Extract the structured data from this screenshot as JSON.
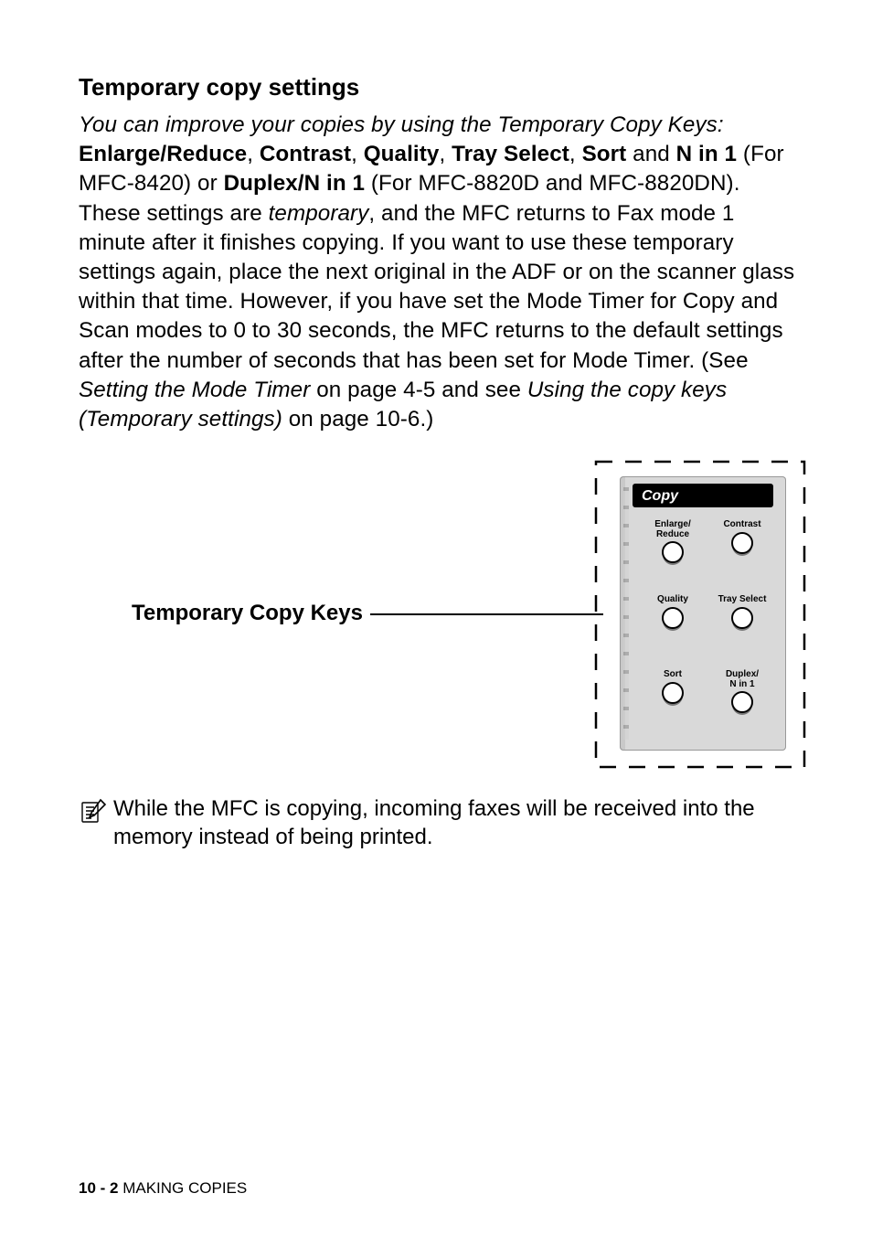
{
  "heading": "Temporary copy settings",
  "body": {
    "intro_italic": "You can improve your copies by using the Temporary Copy Keys: ",
    "k1": "Enlarge/Reduce",
    "c1": ", ",
    "k2": "Contrast",
    "c2": ", ",
    "k3": "Quality",
    "c3": ", ",
    "k4": "Tray Select",
    "c4": ", ",
    "k5": "Sort",
    "t1": " and ",
    "k6": "N in 1",
    "t2": " (For MFC-8420) or ",
    "k7": "Duplex/N in 1",
    "t3": " (For MFC-8820D and MFC-8820DN). These settings are ",
    "temp_i": "temporary",
    "t4": ", and the MFC returns to Fax mode 1 minute after it finishes copying. If you want to use these temporary settings again, place the next original in the ADF or on the scanner glass within that time. However, if you have set the Mode Timer for Copy and Scan modes to 0 to 30 seconds, the MFC returns to the default settings after the number of seconds that has been set for Mode Timer. (See ",
    "ref1_i": "Setting the Mode Timer",
    "t5": " on page 4-5 and see ",
    "ref2_i": "Using the copy keys (Temporary settings)",
    "t6": " on page 10-6.)"
  },
  "diagram": {
    "label": "Temporary Copy Keys",
    "panel_title": "Copy",
    "keys": {
      "k0": "Enlarge/\nReduce",
      "k1": "Contrast",
      "k2": "Quality",
      "k3": "Tray Select",
      "k4": "Sort",
      "k5": "Duplex/\nN in 1"
    }
  },
  "note": "While the MFC is copying, incoming faxes will be received into the memory instead of being printed.",
  "footer": {
    "page": "10 - 2",
    "section": "   MAKING COPIES"
  }
}
